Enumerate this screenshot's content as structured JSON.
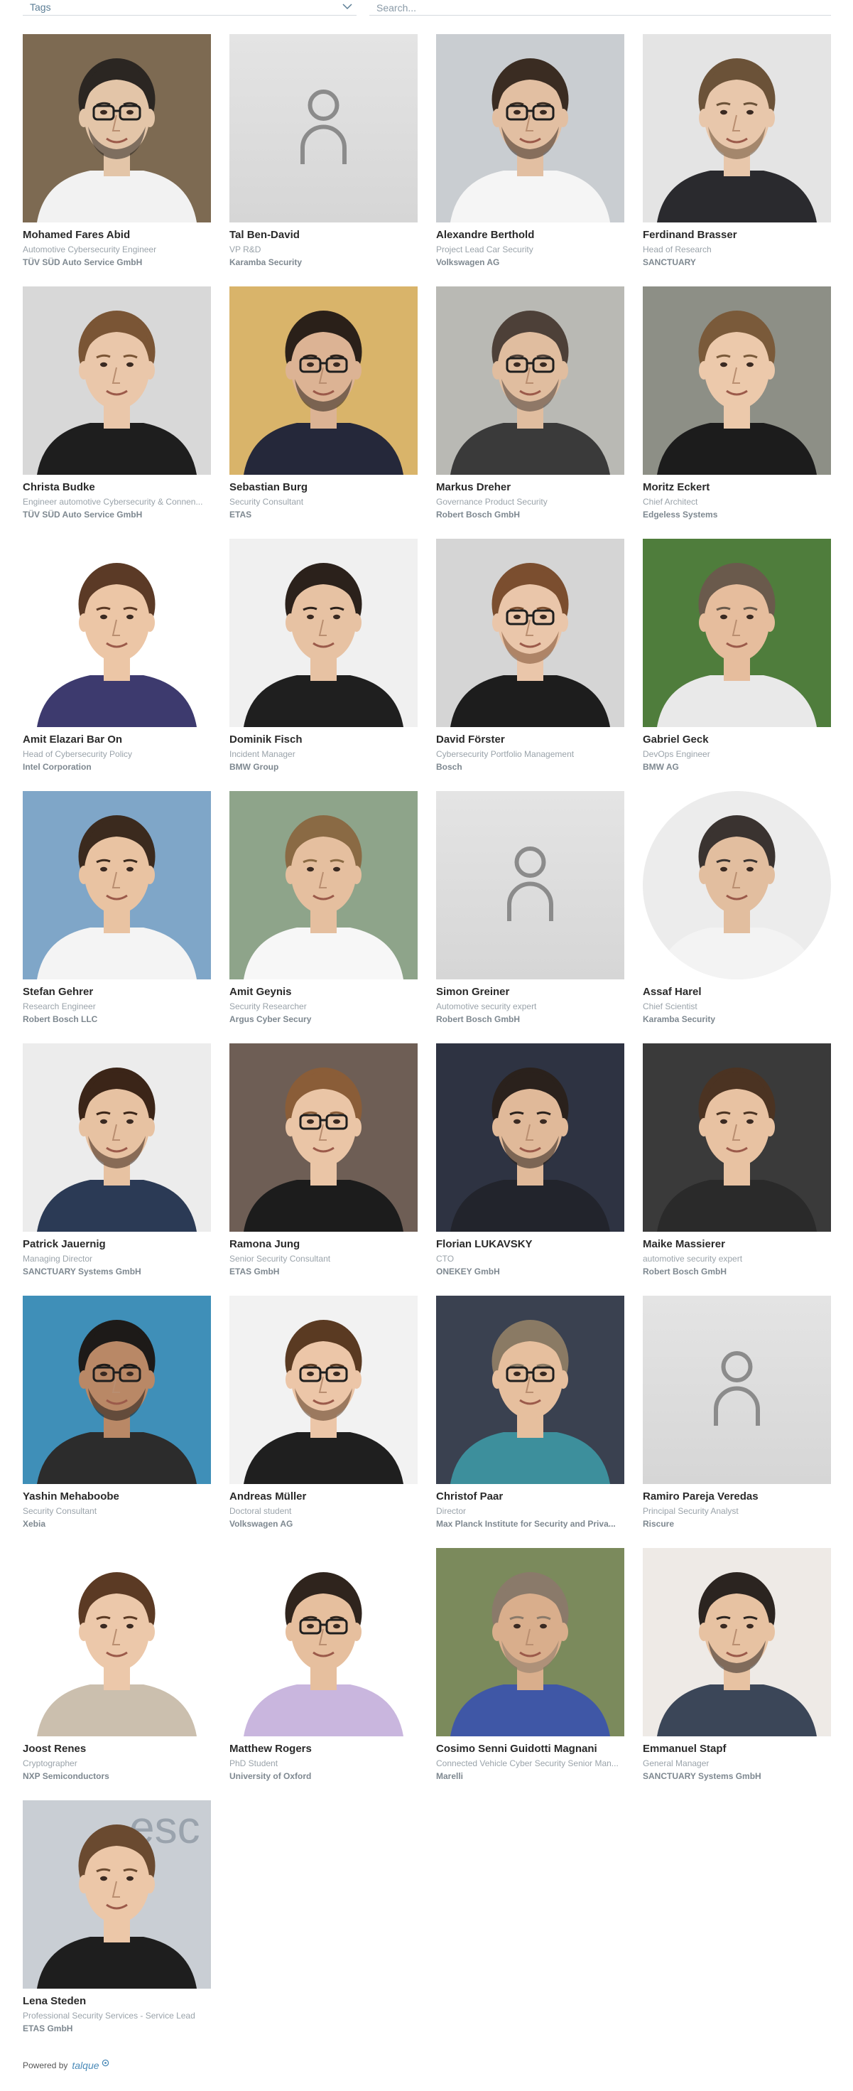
{
  "filters": {
    "tags_label": "Tags",
    "search_placeholder": "Search..."
  },
  "people": [
    {
      "name": "Mohamed Fares Abid",
      "role": "Automotive Cybersecurity Engineer",
      "company": "TÜV SÜD Auto Service GmbH",
      "photo": "photo",
      "bg": "#7d6a52",
      "skin": "#e3c5a8",
      "hair": "#2b2622",
      "shirt": "#f2f2f2",
      "glasses": true,
      "beard": true
    },
    {
      "name": "Tal Ben-David",
      "role": "VP R&D",
      "company": "Karamba Security",
      "photo": "placeholder"
    },
    {
      "name": "Alexandre Berthold",
      "role": "Project Lead Car Security",
      "company": "Volkswagen AG",
      "photo": "photo",
      "bg": "#c9cdd1",
      "skin": "#e2bfa2",
      "hair": "#3a2c22",
      "shirt": "#f5f5f5",
      "glasses": true,
      "beard": true
    },
    {
      "name": "Ferdinand Brasser",
      "role": "Head of Research",
      "company": "SANCTUARY",
      "photo": "photo",
      "bg": "#e4e4e4",
      "skin": "#e8c7ab",
      "hair": "#6b5238",
      "shirt": "#2a2a2e",
      "glasses": false,
      "beard": true
    },
    {
      "name": "Christa Budke",
      "role": "Engineer automotive Cybersecurity & Connen...",
      "company": "TÜV SÜD Auto Service GmbH",
      "photo": "photo",
      "bg": "#d8d8d8",
      "skin": "#eac7aa",
      "hair": "#7a5535",
      "shirt": "#1e1e1e",
      "glasses": false,
      "beard": false
    },
    {
      "name": "Sebastian Burg",
      "role": "Security Consultant",
      "company": "ETAS",
      "photo": "photo",
      "bg": "#d9b46a",
      "skin": "#dcb394",
      "hair": "#2a2019",
      "shirt": "#25283a",
      "glasses": true,
      "beard": true
    },
    {
      "name": "Markus Dreher",
      "role": "Governance Product Security",
      "company": "Robert Bosch GmbH",
      "photo": "photo",
      "bg": "#b9b9b4",
      "skin": "#e0bd9f",
      "hair": "#4d4038",
      "shirt": "#3a3a3a",
      "glasses": true,
      "beard": true
    },
    {
      "name": "Moritz Eckert",
      "role": "Chief Architect",
      "company": "Edgeless Systems",
      "photo": "photo",
      "bg": "#8d8f86",
      "skin": "#ecc9ab",
      "hair": "#7a5a3a",
      "shirt": "#1c1c1c",
      "glasses": false,
      "beard": false
    },
    {
      "name": "Amit Elazari Bar On",
      "role": "Head of Cybersecurity Policy",
      "company": "Intel Corporation",
      "photo": "photo",
      "bg": "#ffffff",
      "skin": "#ecc6a6",
      "hair": "#5b3a26",
      "shirt": "#3d3a6e",
      "glasses": false,
      "beard": false
    },
    {
      "name": "Dominik Fisch",
      "role": "Incident Manager",
      "company": "BMW Group",
      "photo": "photo",
      "bg": "#f0f0f0",
      "skin": "#e7c2a3",
      "hair": "#2b211b",
      "shirt": "#1f1f1f",
      "glasses": false,
      "beard": false
    },
    {
      "name": "David Förster",
      "role": "Cybersecurity Portfolio Management",
      "company": "Bosch",
      "photo": "photo",
      "bg": "#d5d5d5",
      "skin": "#eac6aa",
      "hair": "#7b4e2f",
      "shirt": "#1d1d1d",
      "glasses": true,
      "beard": true
    },
    {
      "name": "Gabriel Geck",
      "role": "DevOps Engineer",
      "company": "BMW AG",
      "photo": "photo",
      "bg": "#4f7d3c",
      "skin": "#e6bd9d",
      "hair": "#6a5a4c",
      "shirt": "#e9e9e9",
      "glasses": false,
      "beard": false
    },
    {
      "name": "Stefan Gehrer",
      "role": "Research Engineer",
      "company": "Robert Bosch LLC",
      "photo": "photo",
      "bg": "#7fa6c8",
      "skin": "#e9c3a2",
      "hair": "#3b2a1e",
      "shirt": "#f4f4f4",
      "glasses": false,
      "beard": false
    },
    {
      "name": "Amit Geynis",
      "role": "Security Researcher",
      "company": "Argus Cyber Secury",
      "photo": "photo",
      "bg": "#8ea48a",
      "skin": "#e5bf9f",
      "hair": "#8a6a44",
      "shirt": "#f7f7f7",
      "glasses": false,
      "beard": false
    },
    {
      "name": "Simon Greiner",
      "role": "Automotive security expert",
      "company": "Robert Bosch GmbH",
      "photo": "placeholder"
    },
    {
      "name": "Assaf Harel",
      "role": "Chief Scientist",
      "company": "Karamba Security",
      "photo": "photo",
      "round": true,
      "bg": "#ececec",
      "skin": "#e2be9f",
      "hair": "#3a3330",
      "shirt": "#f3f3f3",
      "glasses": false,
      "beard": false
    },
    {
      "name": "Patrick Jauernig",
      "role": "Managing Director",
      "company": "SANCTUARY Systems GmbH",
      "photo": "photo",
      "bg": "#ececec",
      "skin": "#e7c2a2",
      "hair": "#3b2518",
      "shirt": "#2b3a55",
      "glasses": false,
      "beard": true
    },
    {
      "name": "Ramona Jung",
      "role": "Senior Security Consultant",
      "company": "ETAS GmbH",
      "photo": "photo",
      "bg": "#6e5e55",
      "skin": "#eac5a6",
      "hair": "#8a5d38",
      "shirt": "#1c1c1c",
      "glasses": true,
      "beard": false
    },
    {
      "name": "Florian LUKAVSKY",
      "role": "CTO",
      "company": "ONEKEY GmbH",
      "photo": "photo",
      "bg": "#2e3342",
      "skin": "#e0b999",
      "hair": "#2a211c",
      "shirt": "#22242c",
      "glasses": false,
      "beard": true
    },
    {
      "name": "Maike Massierer",
      "role": "automotive security expert",
      "company": "Robert Bosch GmbH",
      "photo": "photo",
      "bg": "#3a3a3a",
      "skin": "#e8c2a2",
      "hair": "#4b3322",
      "shirt": "#2a2a2a",
      "glasses": false,
      "beard": false
    },
    {
      "name": "Yashin Mehaboobe",
      "role": "Security Consultant",
      "company": "Xebia",
      "photo": "photo",
      "bg": "#3f8fb8",
      "skin": "#b98866",
      "hair": "#1d1a18",
      "shirt": "#2c2c2c",
      "glasses": true,
      "beard": true
    },
    {
      "name": "Andreas Müller",
      "role": "Doctoral student",
      "company": "Volkswagen AG",
      "photo": "photo",
      "bg": "#f2f2f2",
      "skin": "#ecc6a8",
      "hair": "#5a3a22",
      "shirt": "#1f1f1f",
      "glasses": true,
      "beard": true
    },
    {
      "name": "Christof Paar",
      "role": "Director",
      "company": "Max Planck Institute for Security and Priva...",
      "photo": "photo",
      "bg": "#3a4150",
      "skin": "#e6bf9e",
      "hair": "#8a7a64",
      "shirt": "#3d8f9c",
      "glasses": true,
      "beard": false
    },
    {
      "name": "Ramiro Pareja Veredas",
      "role": "Principal Security Analyst",
      "company": "Riscure",
      "photo": "placeholder"
    },
    {
      "name": "Joost Renes",
      "role": "Cryptographer",
      "company": "NXP Semiconductors",
      "photo": "photo",
      "bg": "#ffffff",
      "skin": "#ecc8aa",
      "hair": "#5b3a24",
      "shirt": "#cbbfae",
      "glasses": false,
      "beard": false
    },
    {
      "name": "Matthew Rogers",
      "role": "PhD Student",
      "company": "University of Oxford",
      "photo": "photo",
      "bg": "#ffffff",
      "skin": "#e6bf9e",
      "hair": "#2f241d",
      "shirt": "#c9b6de",
      "glasses": true,
      "beard": false
    },
    {
      "name": "Cosimo Senni Guidotti Magnani",
      "role": "Connected Vehicle Cyber Security Senior Man...",
      "company": "Marelli",
      "photo": "photo",
      "bg": "#7b8a5c",
      "skin": "#d9ae8c",
      "hair": "#8a7a6a",
      "shirt": "#3f57a6",
      "glasses": false,
      "beard": true
    },
    {
      "name": "Emmanuel Stapf",
      "role": "General Manager",
      "company": "SANCTUARY Systems GmbH",
      "photo": "photo",
      "bg": "#eeeae6",
      "skin": "#e7c2a2",
      "hair": "#2b2420",
      "shirt": "#3b4658",
      "glasses": false,
      "beard": true
    },
    {
      "name": "Lena Steden",
      "role": "Professional Security Services - Service Lead",
      "company": "ETAS GmbH",
      "photo": "photo",
      "bg": "#c9ced4",
      "skin": "#ecc7a8",
      "hair": "#6a4a30",
      "shirt": "#1e1e1e",
      "glasses": false,
      "beard": false,
      "signage": "esc"
    }
  ],
  "footer": {
    "powered_by": "Powered by",
    "brand": "talque"
  }
}
